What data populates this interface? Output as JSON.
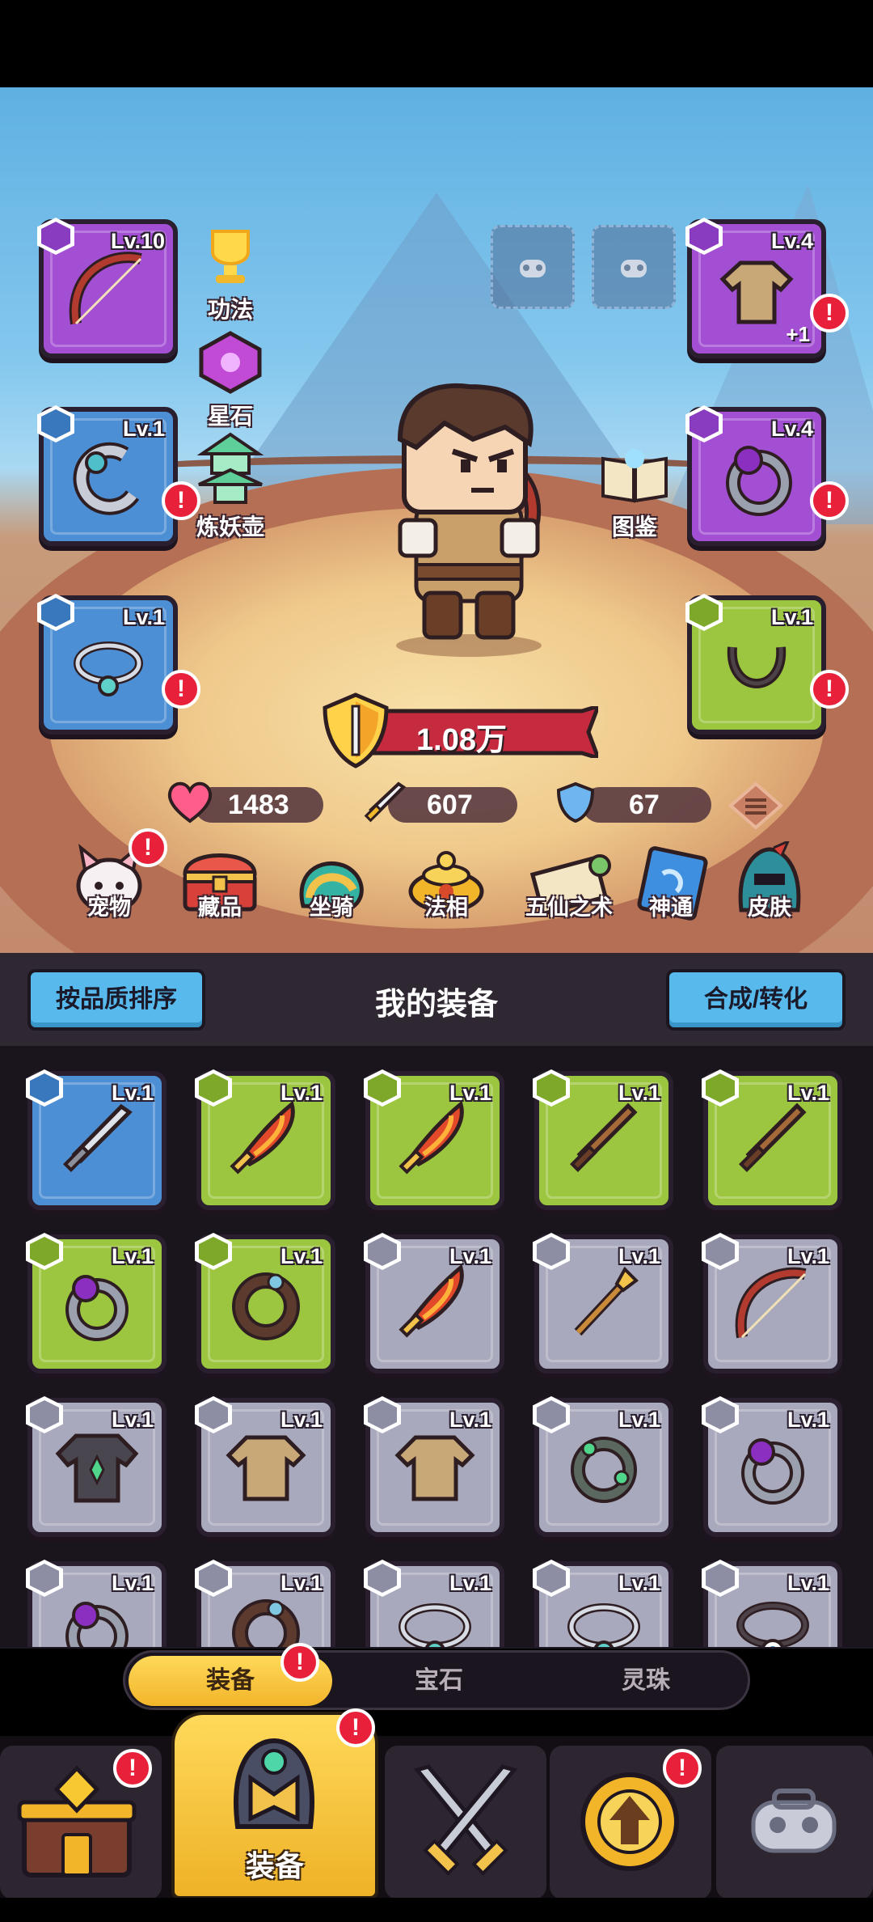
{
  "character_slots": {
    "weapon": {
      "level": "Lv.10",
      "quality_icon": "sword-icon"
    },
    "armor": {
      "level": "Lv.4",
      "quality_icon": "armor-icon",
      "plus": "+1",
      "alert": "!"
    },
    "ring_left": {
      "level": "Lv.1",
      "quality_icon": "ring-icon",
      "alert": "!"
    },
    "ring_right": {
      "level": "Lv.4",
      "quality_icon": "ring-icon",
      "alert": "!"
    },
    "necklace_left": {
      "level": "Lv.1",
      "quality_icon": "necklace-icon",
      "alert": "!"
    },
    "necklace_right": {
      "level": "Lv.1",
      "quality_icon": "necklace-icon",
      "alert": "!"
    }
  },
  "side_buttons": {
    "gongfa": "功法",
    "xingshi": "星石",
    "lianyaohu": "炼妖壶",
    "tujian": "图鉴"
  },
  "power": {
    "value": "1.08万"
  },
  "stats": {
    "hp": "1483",
    "attack": "607",
    "defense": "67"
  },
  "menu": [
    {
      "label": "宠物",
      "alert": "!"
    },
    {
      "label": "藏品"
    },
    {
      "label": "坐骑"
    },
    {
      "label": "法相"
    },
    {
      "label": "五仙之术"
    },
    {
      "label": "神通"
    },
    {
      "label": "皮肤"
    }
  ],
  "panel": {
    "sort_label": "按品质排序",
    "title": "我的装备",
    "compose_label": "合成/转化"
  },
  "inventory": [
    {
      "level": "Lv.1",
      "quality": "blue",
      "item": "sword-icon"
    },
    {
      "level": "Lv.1",
      "quality": "green",
      "item": "flame-sword-icon"
    },
    {
      "level": "Lv.1",
      "quality": "green",
      "item": "flame-sword-icon"
    },
    {
      "level": "Lv.1",
      "quality": "green",
      "item": "wooden-sword-icon"
    },
    {
      "level": "Lv.1",
      "quality": "green",
      "item": "wooden-sword-icon"
    },
    {
      "level": "Lv.1",
      "quality": "green",
      "item": "purple-ring-icon"
    },
    {
      "level": "Lv.1",
      "quality": "green",
      "item": "dark-ring-icon"
    },
    {
      "level": "Lv.1",
      "quality": "gray",
      "item": "flame-sword-icon"
    },
    {
      "level": "Lv.1",
      "quality": "gray",
      "item": "spear-icon"
    },
    {
      "level": "Lv.1",
      "quality": "gray",
      "item": "bow-icon"
    },
    {
      "level": "Lv.1",
      "quality": "gray",
      "item": "dark-robe-icon"
    },
    {
      "level": "Lv.1",
      "quality": "gray",
      "item": "tunic-icon"
    },
    {
      "level": "Lv.1",
      "quality": "gray",
      "item": "tunic-icon"
    },
    {
      "level": "Lv.1",
      "quality": "gray",
      "item": "jade-ring-icon"
    },
    {
      "level": "Lv.1",
      "quality": "gray",
      "item": "purple-ring-icon"
    },
    {
      "level": "Lv.1",
      "quality": "gray",
      "item": "purple-ring-icon"
    },
    {
      "level": "Lv.1",
      "quality": "gray",
      "item": "dark-ring-icon"
    },
    {
      "level": "Lv.1",
      "quality": "gray",
      "item": "necklace-icon"
    },
    {
      "level": "Lv.1",
      "quality": "gray",
      "item": "necklace-icon"
    },
    {
      "level": "Lv.1",
      "quality": "gray",
      "item": "eye-necklace-icon"
    }
  ],
  "tabs": [
    {
      "label": "装备",
      "active": true,
      "alert": "!"
    },
    {
      "label": "宝石"
    },
    {
      "label": "灵珠"
    }
  ],
  "bottom_nav": [
    {
      "icon": "shop-icon",
      "alert": "!"
    },
    {
      "icon": "equipment-helmet-icon",
      "label": "装备",
      "active": true,
      "alert": "!"
    },
    {
      "icon": "battle-swords-icon"
    },
    {
      "icon": "upgrade-arrow-icon",
      "alert": "!"
    },
    {
      "icon": "cloud-lock-icon"
    }
  ],
  "colors": {
    "quality_purple": "#a24fd3",
    "quality_blue": "#4d8fd4",
    "quality_green": "#9cc63f",
    "quality_gray": "#a8a9bd",
    "alert_red": "#e8203a",
    "button_blue": "#57b9ec",
    "tab_gold": "#f2b52a"
  }
}
